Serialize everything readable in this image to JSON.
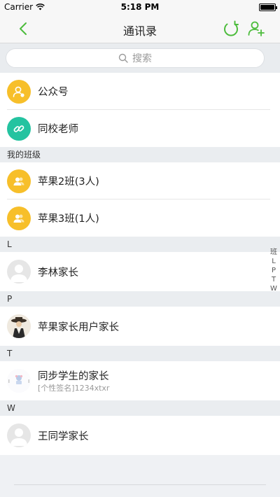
{
  "status_bar": {
    "carrier": "Carrier",
    "time": "5:18 PM"
  },
  "nav": {
    "title": "通讯录"
  },
  "search": {
    "placeholder": "搜索"
  },
  "top_items": [
    {
      "label": "公众号"
    },
    {
      "label": "同校老师"
    }
  ],
  "sections": {
    "my_classes": "我的班级",
    "L": "L",
    "P": "P",
    "T": "T",
    "W": "W"
  },
  "classes": [
    {
      "label": "苹果2班(3人)"
    },
    {
      "label": "苹果3班(1人)"
    }
  ],
  "contacts": {
    "L": [
      {
        "name": "李林家长"
      }
    ],
    "P": [
      {
        "name": "苹果家长用户家长"
      }
    ],
    "T": [
      {
        "name": "同步学生的家长",
        "signature": "[个性签名]1234xtxr"
      }
    ],
    "W": [
      {
        "name": "王同学家长"
      }
    ]
  },
  "index": [
    "班",
    "L",
    "P",
    "T",
    "W"
  ],
  "colors": {
    "accent": "#4cbc3c",
    "yellow": "#f7bf2a",
    "teal": "#24c3a0"
  }
}
